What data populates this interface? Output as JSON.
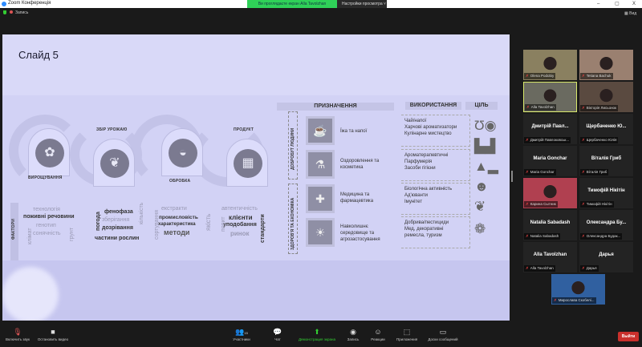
{
  "window": {
    "title": "Zoom Конференція",
    "share_banner": "Ви проглядаєте екран Alla Tavolzhan",
    "view_options": "Настройки просмотра",
    "minimize": "–",
    "restore": "▢",
    "close": "X",
    "recording": "Запись",
    "view": "Вид"
  },
  "slide": {
    "title": "Слайд 5",
    "stages": [
      {
        "label": "ВИРОЩУВАННЯ"
      },
      {
        "label": "ЗБІР УРОЖАЮ"
      },
      {
        "label": "ОБРОБКА"
      },
      {
        "label": "ПРОДУКТ"
      }
    ],
    "factors_label": "ФАКТОРИ",
    "words1": [
      "технологія",
      "поживні речовини",
      "генотип",
      "сонячність",
      "клімат",
      "грунт"
    ],
    "words2": [
      "фенофаза",
      "зберігання",
      "дозрівання",
      "частини рослин",
      "погода",
      "кількість"
    ],
    "words3": [
      "екстракти",
      "промисловість",
      "характеристика",
      "методи",
      "сортування",
      "якість"
    ],
    "words4": [
      "автентичність",
      "клієнти",
      "уподобання",
      "ринок",
      "попит",
      "стандарти"
    ],
    "headers": {
      "purpose": "ПРИЗНАЧЕННЯ",
      "usage": "ВИКОРИСТАННЯ",
      "goal": "ЦІЛЬ"
    },
    "groups": [
      "ДОБРОБУТ ЛЮДИНИ",
      "ЗДОРОВ'Я ТА ЕКОНОМІКА"
    ],
    "rows": [
      {
        "purpose": "Їжа та напої",
        "usage": [
          "Чай/напої",
          "Харчові ароматизатори",
          "Кулінарне мистецтво"
        ]
      },
      {
        "purpose": "Оздоровлення та косметика",
        "usage": [
          "Ароматерапевтичні",
          "Парфумерія",
          "Засоби гігієни"
        ]
      },
      {
        "purpose": "Медицина та фармацевтика",
        "usage": [
          "Біологічна активність",
          "Ад'юванти",
          "Імунітет"
        ]
      },
      {
        "purpose": "Навколишнє середовище та агрозастосування",
        "usage": [
          "Добрива/пестициди",
          "Мед, декоративні",
          "ремесла, туризм"
        ]
      }
    ]
  },
  "participants": [
    {
      "name": "",
      "caption": "Olena Podobiy",
      "video": "#8a8060"
    },
    {
      "name": "",
      "caption": "Tetiana Bachuk",
      "video": "#9a8070"
    },
    {
      "name": "",
      "caption": "Alla Tavolzhan",
      "video": "#6a6a60",
      "active": true
    },
    {
      "name": "",
      "caption": "Вікторія Лисьонок",
      "video": "#5a4a40"
    },
    {
      "name": "Дмитрій Павл...",
      "caption": "Дмитрій Павлоковськ..."
    },
    {
      "name": "Щербаченко Ю...",
      "caption": "Щербаченко Юлія"
    },
    {
      "name": "Maria Gonchar",
      "caption": "Maria Gonchar"
    },
    {
      "name": "Віталія Гриб",
      "caption": "Віталія Гриб"
    },
    {
      "name": "",
      "caption": "Карина Сытник",
      "video": "#b04050"
    },
    {
      "name": "Тимофій Нікітін",
      "caption": "Тимофій Нікітін"
    },
    {
      "name": "Natalia Sabadash",
      "caption": "Natalia Sabadash"
    },
    {
      "name": "Олександра Бу...",
      "caption": "Олександра Будак..."
    },
    {
      "name": "Alla Tavolzhan",
      "caption": "Alla Tavolzhan"
    },
    {
      "name": "Дарья",
      "caption": "Дарья"
    },
    {
      "name": "",
      "caption": "Мирослава Скобелі...",
      "video": "#3060a0"
    }
  ],
  "toolbar": {
    "mute": "Включить звук",
    "video": "Остановить видео",
    "participants": "Участники",
    "participants_count": "15",
    "chat": "Чат",
    "share": "Демонстрация экрана",
    "record": "Запись",
    "reactions": "Реакции",
    "apps": "Приложения",
    "whiteboard": "Доски сообщений",
    "leave": "Выйти"
  }
}
